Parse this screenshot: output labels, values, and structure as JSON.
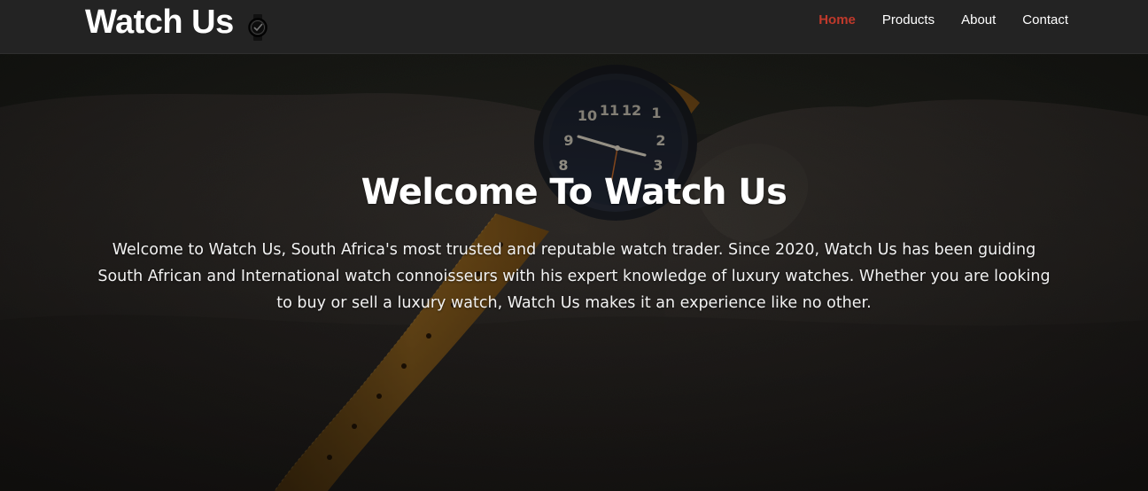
{
  "brand": {
    "name": "Watch Us",
    "icon": "watch-icon"
  },
  "nav": {
    "items": [
      {
        "label": "Home",
        "active": true
      },
      {
        "label": "Products",
        "active": false
      },
      {
        "label": "About",
        "active": false
      },
      {
        "label": "Contact",
        "active": false
      }
    ],
    "active_color": "#c0392b"
  },
  "hero": {
    "title": "Welcome To Watch Us",
    "text": "Welcome to Watch Us, South Africa's most trusted and reputable watch trader. Since 2020, Watch Us has been guiding South African and International watch connoisseurs with his expert knowledge of luxury watches. Whether you are looking to buy or sell a luxury watch, Watch Us makes it an experience like no other.",
    "image": "watch-on-rock-photo",
    "watch_face_numbers": [
      "11",
      "12",
      "1",
      "10",
      "2",
      "9",
      "3",
      "8"
    ]
  }
}
